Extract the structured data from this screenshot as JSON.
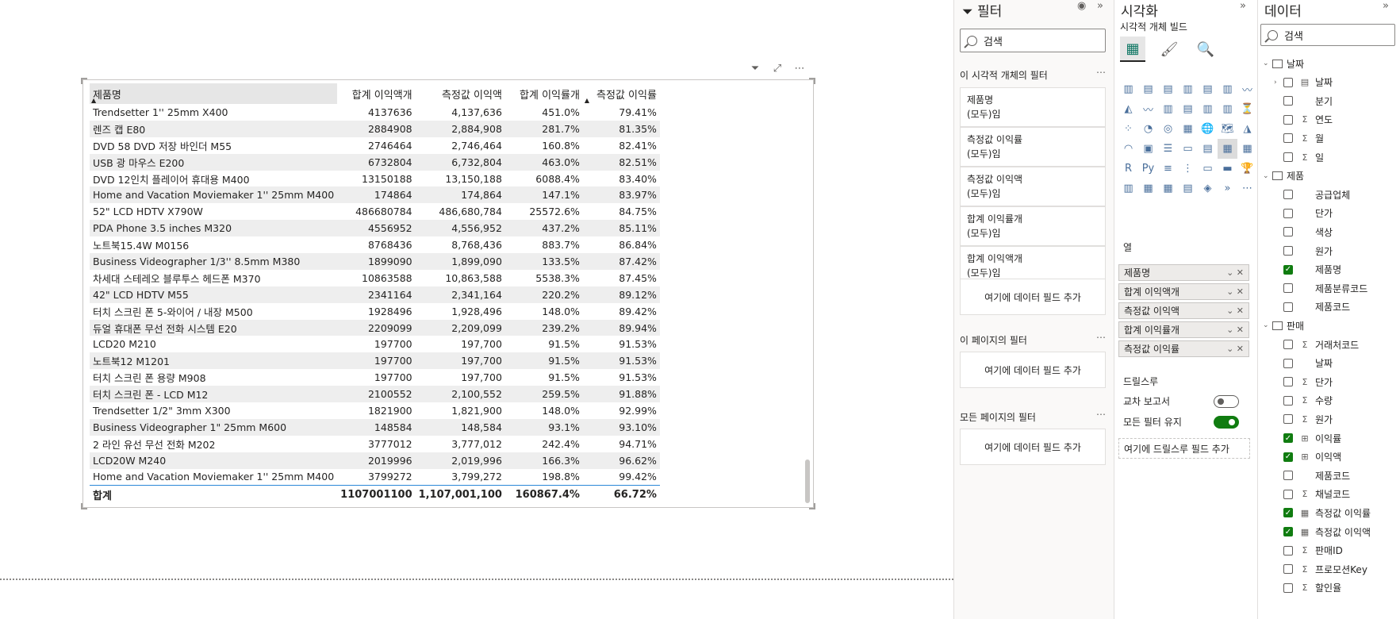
{
  "table": {
    "headers": [
      "제품명",
      "합계 이익액개",
      "측정값 이익액",
      "합계 이익률개",
      "측정값 이익률"
    ],
    "rows": [
      [
        "Trendsetter 1'' 25mm X400",
        "4137636",
        "4,137,636",
        "451.0%",
        "79.41%"
      ],
      [
        "렌즈 캡 E80",
        "2884908",
        "2,884,908",
        "281.7%",
        "81.35%"
      ],
      [
        "DVD 58 DVD 저장 바인더 M55",
        "2746464",
        "2,746,464",
        "160.8%",
        "82.41%"
      ],
      [
        "USB 광 마우스 E200",
        "6732804",
        "6,732,804",
        "463.0%",
        "82.51%"
      ],
      [
        "DVD 12인치 플레이어 휴대용 M400",
        "13150188",
        "13,150,188",
        "6088.4%",
        "83.40%"
      ],
      [
        "Home and Vacation Moviemaker 1'' 25mm M400",
        "174864",
        "174,864",
        "147.1%",
        "83.97%"
      ],
      [
        "52\" LCD HDTV X790W",
        "486680784",
        "486,680,784",
        "25572.6%",
        "84.75%"
      ],
      [
        "PDA Phone 3.5 inches M320",
        "4556952",
        "4,556,952",
        "437.2%",
        "85.11%"
      ],
      [
        "노트북15.4W M0156",
        "8768436",
        "8,768,436",
        "883.7%",
        "86.84%"
      ],
      [
        "Business Videographer 1/3'' 8.5mm M380",
        "1899090",
        "1,899,090",
        "133.5%",
        "87.42%"
      ],
      [
        "차세대 스테레오 블루투스 헤드폰 M370",
        "10863588",
        "10,863,588",
        "5538.3%",
        "87.45%"
      ],
      [
        "42\" LCD HDTV M55",
        "2341164",
        "2,341,164",
        "220.2%",
        "89.12%"
      ],
      [
        "터치 스크린 폰 5-와이어 / 내장 M500",
        "1928496",
        "1,928,496",
        "148.0%",
        "89.42%"
      ],
      [
        "듀얼 휴대폰 무선 전화 시스템 E20",
        "2209099",
        "2,209,099",
        "239.2%",
        "89.94%"
      ],
      [
        "LCD20 M210",
        "197700",
        "197,700",
        "91.5%",
        "91.53%"
      ],
      [
        "노트북12 M1201",
        "197700",
        "197,700",
        "91.5%",
        "91.53%"
      ],
      [
        "터치 스크린 폰 용량 M908",
        "197700",
        "197,700",
        "91.5%",
        "91.53%"
      ],
      [
        "터치 스크린 폰 - LCD M12",
        "2100552",
        "2,100,552",
        "259.5%",
        "91.88%"
      ],
      [
        "Trendsetter 1/2\" 3mm X300",
        "1821900",
        "1,821,900",
        "148.0%",
        "92.99%"
      ],
      [
        "Business Videographer 1\" 25mm M600",
        "148584",
        "148,584",
        "93.1%",
        "93.10%"
      ],
      [
        "2 라인 유선 무선 전화 M202",
        "3777012",
        "3,777,012",
        "242.4%",
        "94.71%"
      ],
      [
        "LCD20W M240",
        "2019996",
        "2,019,996",
        "166.3%",
        "96.62%"
      ],
      [
        "Home and Vacation Moviemaker 1'' 25mm M400",
        "3799272",
        "3,799,272",
        "198.8%",
        "99.42%"
      ]
    ],
    "total": [
      "합계",
      "1107001100",
      "1,107,001,100",
      "160867.4%",
      "66.72%"
    ]
  },
  "filters": {
    "title": "필터",
    "search_placeholder": "검색",
    "visual_section": "이 시각적 개체의 필터",
    "cards": [
      {
        "name": "제품명",
        "state": "(모두)임"
      },
      {
        "name": "측정값 이익률",
        "state": "(모두)임"
      },
      {
        "name": "측정값 이익액",
        "state": "(모두)임"
      },
      {
        "name": "합계 이익률개",
        "state": "(모두)임"
      },
      {
        "name": "합계 이익액개",
        "state": "(모두)임"
      }
    ],
    "add_field": "여기에 데이터 필드 추가",
    "page_section": "이 페이지의 필터",
    "all_pages_section": "모든 페이지의 필터"
  },
  "viz": {
    "title": "시각화",
    "subtitle": "시각적 개체 빌드",
    "columns_label": "열",
    "wells": [
      "제품명",
      "합계 이익액개",
      "측정값 이익액",
      "합계 이익률개",
      "측정값 이익률"
    ],
    "drill_label": "드릴스루",
    "cross_report": "교차 보고서",
    "keep_filters": "모든 필터 유지",
    "cross_report_on": false,
    "keep_filters_on": true,
    "drill_add": "여기에 드릴스루 필드 추가"
  },
  "data_pane": {
    "title": "데이터",
    "search_placeholder": "검색",
    "tables": [
      {
        "name": "날짜",
        "fields": [
          {
            "name": "날짜",
            "icon": "hierarchy",
            "checked": false,
            "expandable": true
          },
          {
            "name": "분기",
            "icon": "none",
            "checked": false
          },
          {
            "name": "연도",
            "icon": "sigma",
            "checked": false
          },
          {
            "name": "월",
            "icon": "sigma",
            "checked": false
          },
          {
            "name": "일",
            "icon": "sigma",
            "checked": false
          }
        ]
      },
      {
        "name": "제품",
        "fields": [
          {
            "name": "공급업체",
            "icon": "none",
            "checked": false
          },
          {
            "name": "단가",
            "icon": "none",
            "checked": false
          },
          {
            "name": "색상",
            "icon": "none",
            "checked": false
          },
          {
            "name": "원가",
            "icon": "none",
            "checked": false
          },
          {
            "name": "제품명",
            "icon": "none",
            "checked": true
          },
          {
            "name": "제품분류코드",
            "icon": "none",
            "checked": false
          },
          {
            "name": "제품코드",
            "icon": "none",
            "checked": false
          }
        ]
      },
      {
        "name": "판매",
        "fields": [
          {
            "name": "거래처코드",
            "icon": "sigma",
            "checked": false
          },
          {
            "name": "날짜",
            "icon": "none",
            "checked": false
          },
          {
            "name": "단가",
            "icon": "sigma",
            "checked": false
          },
          {
            "name": "수량",
            "icon": "sigma",
            "checked": false
          },
          {
            "name": "원가",
            "icon": "sigma",
            "checked": false
          },
          {
            "name": "이익률",
            "icon": "calc",
            "checked": true
          },
          {
            "name": "이익액",
            "icon": "calc",
            "checked": true
          },
          {
            "name": "제품코드",
            "icon": "none",
            "checked": false
          },
          {
            "name": "채널코드",
            "icon": "sigma",
            "checked": false
          },
          {
            "name": "측정값 이익률",
            "icon": "measure",
            "checked": true
          },
          {
            "name": "측정값 이익액",
            "icon": "measure",
            "checked": true
          },
          {
            "name": "판매ID",
            "icon": "sigma",
            "checked": false
          },
          {
            "name": "프로모션Key",
            "icon": "sigma",
            "checked": false
          },
          {
            "name": "할인율",
            "icon": "sigma",
            "checked": false
          }
        ]
      }
    ]
  }
}
